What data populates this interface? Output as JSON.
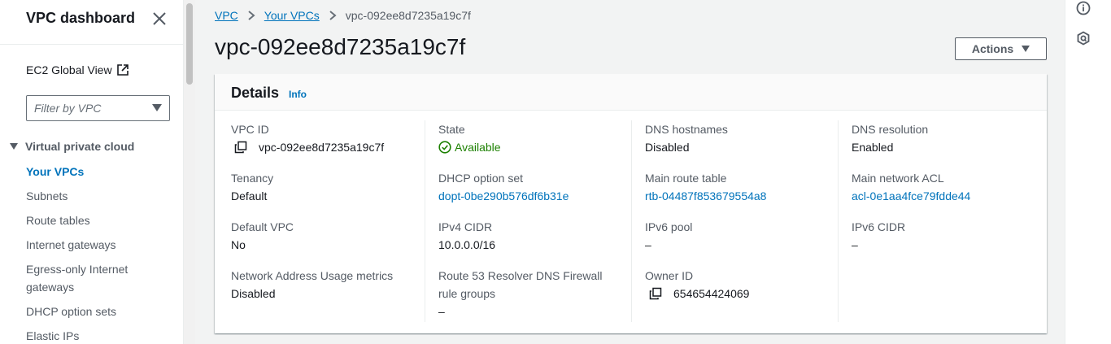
{
  "sidebar": {
    "title": "VPC dashboard",
    "ec2_global_view": "EC2 Global View",
    "filter_placeholder": "Filter by VPC",
    "section_title": "Virtual private cloud",
    "items": [
      {
        "label": "Your VPCs",
        "active": true
      },
      {
        "label": "Subnets"
      },
      {
        "label": "Route tables"
      },
      {
        "label": "Internet gateways"
      },
      {
        "label": "Egress-only Internet gateways"
      },
      {
        "label": "DHCP option sets"
      },
      {
        "label": "Elastic IPs"
      }
    ]
  },
  "breadcrumb": [
    "VPC",
    "Your VPCs",
    "vpc-092ee8d7235a19c7f"
  ],
  "page_title": "vpc-092ee8d7235a19c7f",
  "actions_label": "Actions",
  "details": {
    "title": "Details",
    "info": "Info",
    "columns": [
      [
        {
          "label": "VPC ID",
          "value": "vpc-092ee8d7235a19c7f",
          "copy": true
        },
        {
          "label": "Tenancy",
          "value": "Default"
        },
        {
          "label": "Default VPC",
          "value": "No"
        },
        {
          "label": "Network Address Usage metrics",
          "value": "Disabled"
        }
      ],
      [
        {
          "label": "State",
          "value": "Available",
          "status": "ok"
        },
        {
          "label": "DHCP option set",
          "value": "dopt-0be290b576df6b31e",
          "link": true
        },
        {
          "label": "IPv4 CIDR",
          "value": "10.0.0.0/16"
        },
        {
          "label": "Route 53 Resolver DNS Firewall rule groups",
          "value": "–"
        }
      ],
      [
        {
          "label": "DNS hostnames",
          "value": "Disabled"
        },
        {
          "label": "Main route table",
          "value": "rtb-04487f853679554a8",
          "link": true
        },
        {
          "label": "IPv6 pool",
          "value": "–"
        },
        {
          "label": "Owner ID",
          "value": "654654424069",
          "copy": true
        }
      ],
      [
        {
          "label": "DNS resolution",
          "value": "Enabled"
        },
        {
          "label": "Main network ACL",
          "value": "acl-0e1aa4fce79fdde44",
          "link": true
        },
        {
          "label": "IPv6 CIDR",
          "value": "–"
        }
      ]
    ]
  },
  "colors": {
    "link": "#0073bb",
    "success": "#1d8102",
    "text": "#16191f",
    "muted": "#545b64"
  }
}
